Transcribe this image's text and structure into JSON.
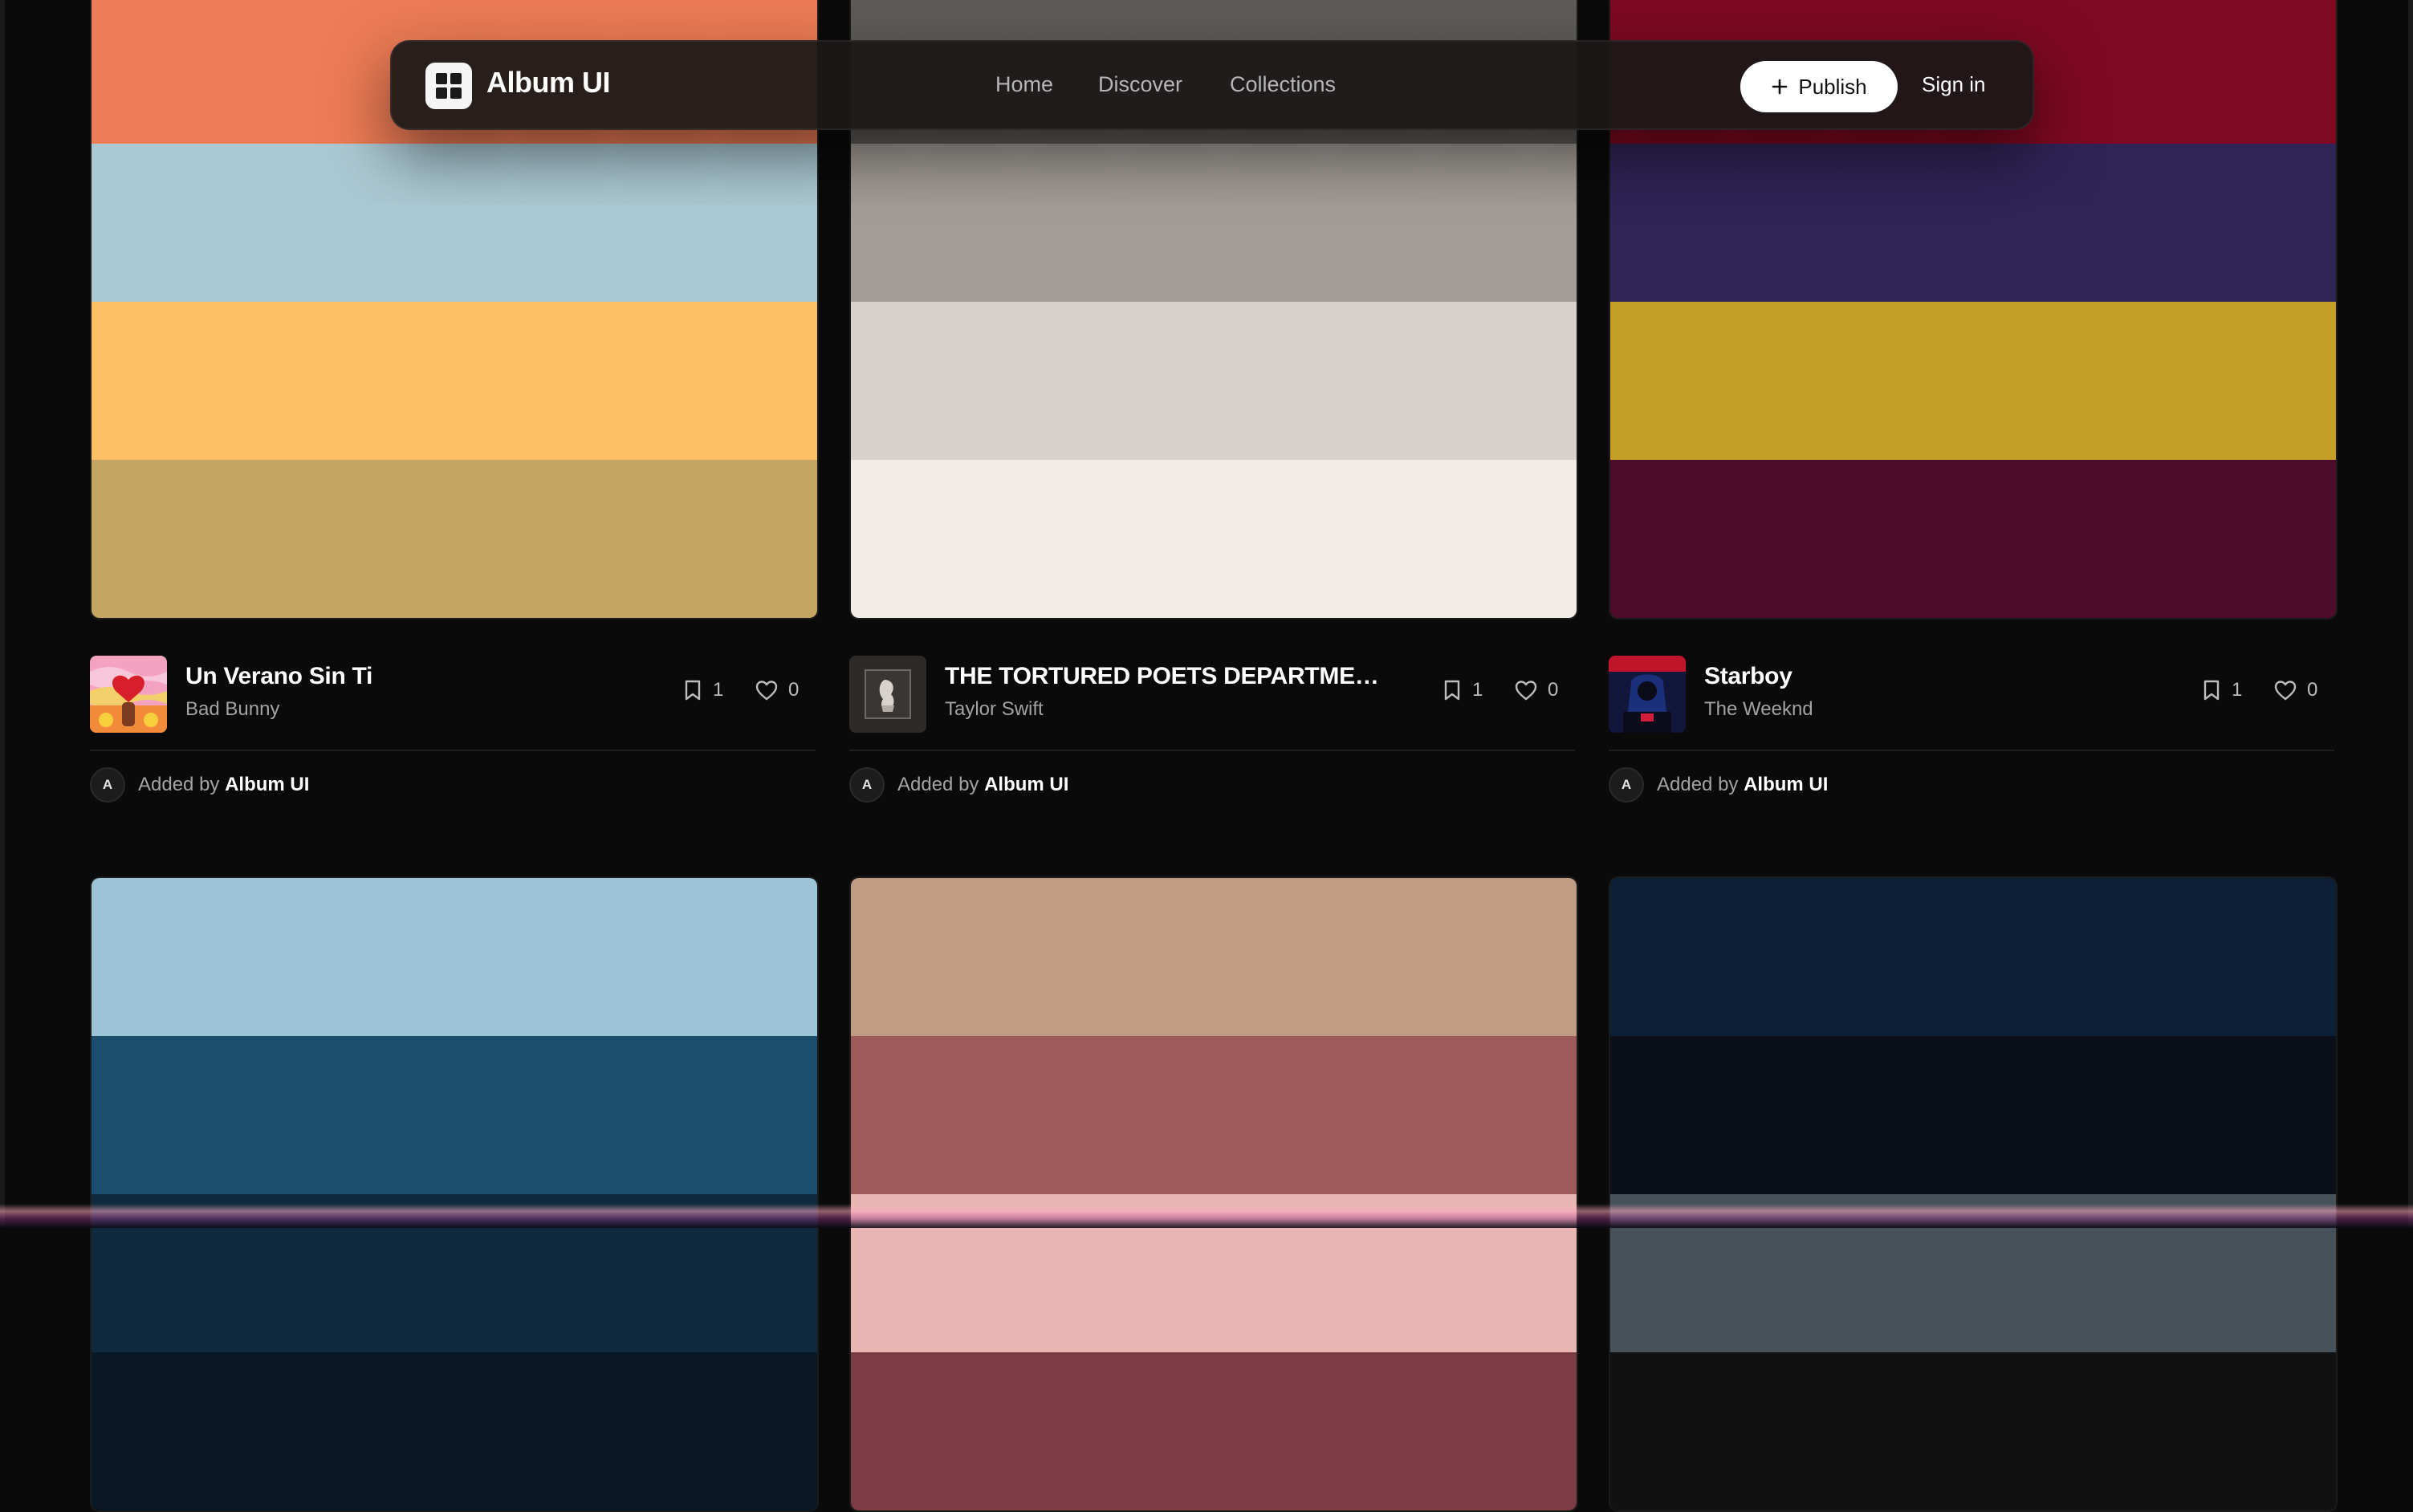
{
  "navbar": {
    "brand": "Album UI",
    "links": [
      "Home",
      "Discover",
      "Collections"
    ],
    "publish_label": "Publish",
    "signin_label": "Sign in"
  },
  "cards": [
    {
      "title": "Un Verano Sin Ti",
      "artist": "Bad Bunny",
      "saves": "1",
      "likes": "0",
      "added_prefix": "Added by",
      "added_by": "Album UI",
      "avatar_letter": "A",
      "colors": [
        "#EE7C56",
        "#ABC9D4",
        "#FDBF64",
        "#C3A561"
      ]
    },
    {
      "title": "THE TORTURED POETS DEPARTMENT: ...",
      "artist": "Taylor Swift",
      "saves": "1",
      "likes": "0",
      "added_prefix": "Added by",
      "added_by": "Album UI",
      "avatar_letter": "A",
      "colors": [
        "#5E5B58",
        "#A29C97",
        "#D7D2CC",
        "#F0EBE5"
      ]
    },
    {
      "title": "Starboy",
      "artist": "The Weeknd",
      "saves": "1",
      "likes": "0",
      "added_prefix": "Added by",
      "added_by": "Album UI",
      "avatar_letter": "A",
      "colors": [
        "#7E0921",
        "#2F2456",
        "#C39F27",
        "#4D0C2A"
      ]
    },
    {
      "colors": [
        "#9DC4D6",
        "#1B4E6C",
        "#0F2A3E",
        "#0A1826"
      ]
    },
    {
      "colors": [
        "#C09C85",
        "#9E5A5B",
        "#E9B6B3",
        "#7B3C46"
      ]
    },
    {
      "colors": [
        "#0C2038",
        "#0B0F18",
        "#475159",
        "#111111"
      ]
    }
  ]
}
